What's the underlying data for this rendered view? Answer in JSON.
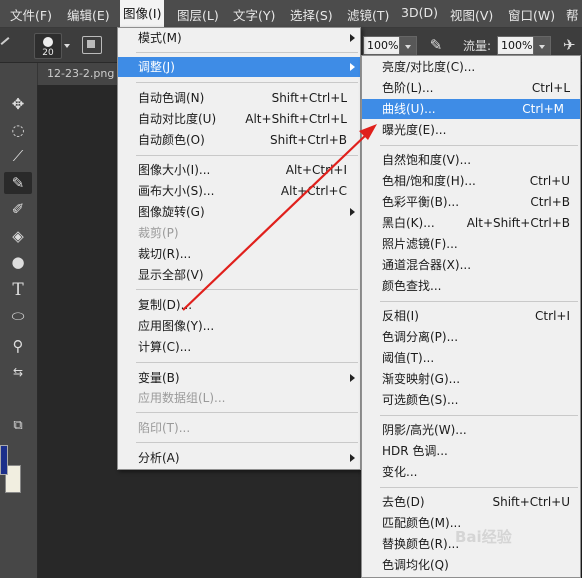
{
  "menubar": {
    "items": [
      "文件(F)",
      "编辑(E)",
      "图像(I)",
      "图层(L)",
      "文字(Y)",
      "选择(S)",
      "滤镜(T)",
      "3D(D)",
      "视图(V)",
      "窗口(W)",
      "帮"
    ],
    "active_index": 2
  },
  "options": {
    "brush_size": "20",
    "opacity": "100%",
    "flow_label": "流量:",
    "flow": "100%"
  },
  "document_tab": "12-23-2.png",
  "image_menu": {
    "items": [
      {
        "label": "模式(M)",
        "shortcut": "",
        "submenu": true
      },
      {
        "label": "调整(J)",
        "shortcut": "",
        "submenu": true,
        "highlighted": true
      },
      {
        "label": "自动色调(N)",
        "shortcut": "Shift+Ctrl+L"
      },
      {
        "label": "自动对比度(U)",
        "shortcut": "Alt+Shift+Ctrl+L"
      },
      {
        "label": "自动颜色(O)",
        "shortcut": "Shift+Ctrl+B"
      },
      {
        "label": "图像大小(I)...",
        "shortcut": "Alt+Ctrl+I"
      },
      {
        "label": "画布大小(S)...",
        "shortcut": "Alt+Ctrl+C"
      },
      {
        "label": "图像旋转(G)",
        "shortcut": "",
        "submenu": true
      },
      {
        "label": "裁剪(P)",
        "shortcut": "",
        "disabled": true
      },
      {
        "label": "裁切(R)...",
        "shortcut": ""
      },
      {
        "label": "显示全部(V)",
        "shortcut": ""
      },
      {
        "label": "复制(D)...",
        "shortcut": ""
      },
      {
        "label": "应用图像(Y)...",
        "shortcut": ""
      },
      {
        "label": "计算(C)...",
        "shortcut": ""
      },
      {
        "label": "变量(B)",
        "shortcut": "",
        "submenu": true
      },
      {
        "label": "应用数据组(L)...",
        "shortcut": "",
        "disabled": true
      },
      {
        "label": "陷印(T)...",
        "shortcut": "",
        "disabled": true
      },
      {
        "label": "分析(A)",
        "shortcut": "",
        "submenu": true
      }
    ]
  },
  "adjust_menu": {
    "items": [
      {
        "label": "亮度/对比度(C)...",
        "shortcut": ""
      },
      {
        "label": "色阶(L)...",
        "shortcut": "Ctrl+L"
      },
      {
        "label": "曲线(U)...",
        "shortcut": "Ctrl+M",
        "highlighted": true
      },
      {
        "label": "曝光度(E)...",
        "shortcut": ""
      },
      {
        "label": "自然饱和度(V)...",
        "shortcut": ""
      },
      {
        "label": "色相/饱和度(H)...",
        "shortcut": "Ctrl+U"
      },
      {
        "label": "色彩平衡(B)...",
        "shortcut": "Ctrl+B"
      },
      {
        "label": "黑白(K)...",
        "shortcut": "Alt+Shift+Ctrl+B"
      },
      {
        "label": "照片滤镜(F)...",
        "shortcut": ""
      },
      {
        "label": "通道混合器(X)...",
        "shortcut": ""
      },
      {
        "label": "颜色查找...",
        "shortcut": ""
      },
      {
        "label": "反相(I)",
        "shortcut": "Ctrl+I"
      },
      {
        "label": "色调分离(P)...",
        "shortcut": ""
      },
      {
        "label": "阈值(T)...",
        "shortcut": ""
      },
      {
        "label": "渐变映射(G)...",
        "shortcut": ""
      },
      {
        "label": "可选颜色(S)...",
        "shortcut": ""
      },
      {
        "label": "阴影/高光(W)...",
        "shortcut": ""
      },
      {
        "label": "HDR 色调...",
        "shortcut": ""
      },
      {
        "label": "变化...",
        "shortcut": ""
      },
      {
        "label": "去色(D)",
        "shortcut": "Shift+Ctrl+U"
      },
      {
        "label": "匹配颜色(M)...",
        "shortcut": ""
      },
      {
        "label": "替换颜色(R)...",
        "shortcut": ""
      },
      {
        "label": "色调均化(Q)",
        "shortcut": ""
      }
    ]
  },
  "watermark": "Bai经验",
  "colors": {
    "menu_highlight": "#3e8ce6",
    "annotation_arrow": "#e0201c",
    "foreground_color": "#1c2f8a",
    "background_color": "#f1eee0"
  }
}
